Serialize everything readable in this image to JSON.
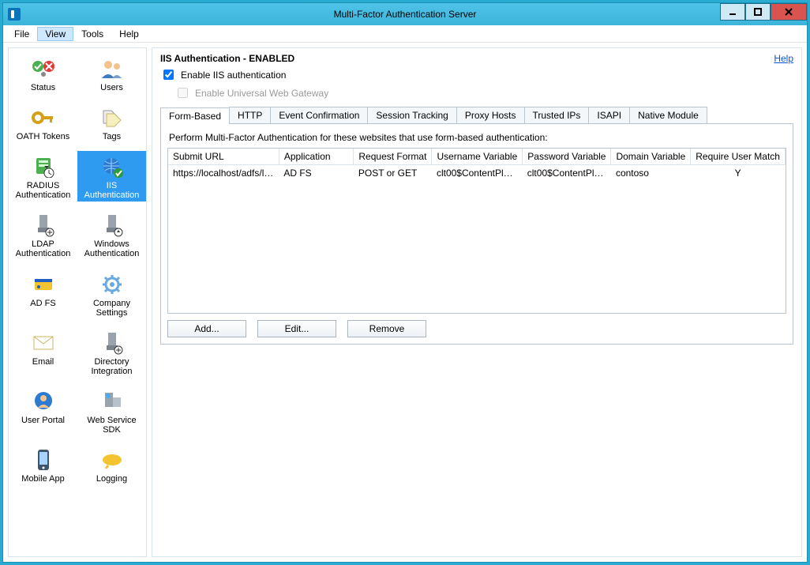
{
  "window": {
    "title": "Multi-Factor Authentication Server"
  },
  "menubar": {
    "file": "File",
    "view": "View",
    "tools": "Tools",
    "help": "Help"
  },
  "sidebar": {
    "items": [
      {
        "id": "status",
        "label": "Status"
      },
      {
        "id": "users",
        "label": "Users"
      },
      {
        "id": "oath-tokens",
        "label": "OATH Tokens"
      },
      {
        "id": "tags",
        "label": "Tags"
      },
      {
        "id": "radius-auth",
        "label": "RADIUS Authentication"
      },
      {
        "id": "iis-auth",
        "label": "IIS Authentication"
      },
      {
        "id": "ldap-auth",
        "label": "LDAP Authentication"
      },
      {
        "id": "windows-auth",
        "label": "Windows Authentication"
      },
      {
        "id": "adfs",
        "label": "AD FS"
      },
      {
        "id": "company-settings",
        "label": "Company Settings"
      },
      {
        "id": "email",
        "label": "Email"
      },
      {
        "id": "directory-integration",
        "label": "Directory Integration"
      },
      {
        "id": "user-portal",
        "label": "User Portal"
      },
      {
        "id": "web-service-sdk",
        "label": "Web Service SDK"
      },
      {
        "id": "mobile-app",
        "label": "Mobile App"
      },
      {
        "id": "logging",
        "label": "Logging"
      }
    ],
    "selected": "iis-auth"
  },
  "main": {
    "heading": "IIS Authentication - ENABLED",
    "help_link": "Help",
    "enable_iis_label": "Enable IIS authentication",
    "enable_iis_checked": true,
    "enable_uwg_label": "Enable Universal Web Gateway",
    "enable_uwg_checked": false,
    "tabs": [
      {
        "id": "form",
        "label": "Form-Based"
      },
      {
        "id": "http",
        "label": "HTTP"
      },
      {
        "id": "event",
        "label": "Event Confirmation"
      },
      {
        "id": "session",
        "label": "Session Tracking"
      },
      {
        "id": "proxy",
        "label": "Proxy Hosts"
      },
      {
        "id": "trusted",
        "label": "Trusted IPs"
      },
      {
        "id": "isapi",
        "label": "ISAPI"
      },
      {
        "id": "native",
        "label": "Native Module"
      }
    ],
    "active_tab": "form",
    "instruction": "Perform Multi-Factor Authentication for these websites that use form-based authentication:",
    "columns": [
      "Submit URL",
      "Application",
      "Request Format",
      "Username Variable",
      "Password Variable",
      "Domain Variable",
      "Require User Match"
    ],
    "rows": [
      {
        "submit_url": "https://localhost/adfs/ls/l...",
        "application": "AD FS",
        "request_format": "POST or GET",
        "username_var": "clt00$ContentPlac...",
        "password_var": "clt00$ContentPla...",
        "domain_var": "contoso",
        "require_match": "Y"
      }
    ],
    "buttons": {
      "add": "Add...",
      "edit": "Edit...",
      "remove": "Remove"
    }
  }
}
